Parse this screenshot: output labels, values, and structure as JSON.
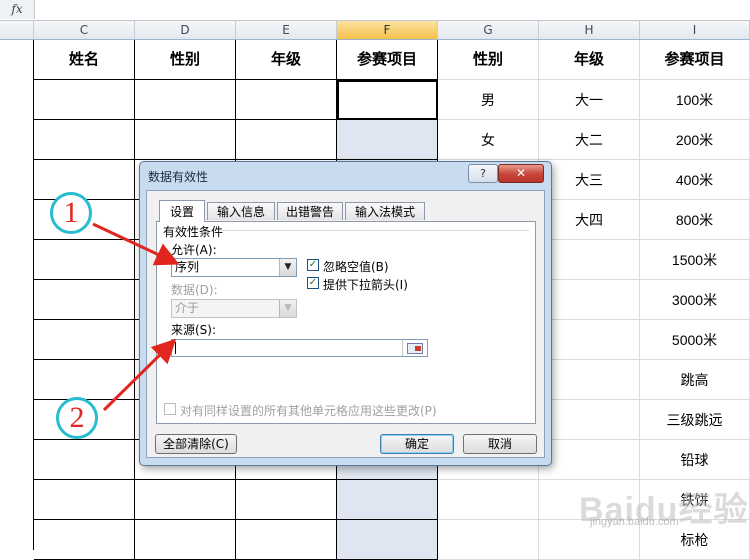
{
  "formula_bar": {
    "fx_label": "fx"
  },
  "columns": [
    {
      "letter": "C"
    },
    {
      "letter": "D"
    },
    {
      "letter": "E"
    },
    {
      "letter": "F"
    },
    {
      "letter": "G"
    },
    {
      "letter": "H"
    },
    {
      "letter": "I"
    }
  ],
  "sheet": {
    "headers": [
      "姓名",
      "性别",
      "年级",
      "参赛项目",
      "性别",
      "年级",
      "参赛项目"
    ],
    "list_gender": [
      "男",
      "女"
    ],
    "list_grade": [
      "大一",
      "大二",
      "大三",
      "大四"
    ],
    "list_events": [
      "100米",
      "200米",
      "400米",
      "800米",
      "1500米",
      "3000米",
      "5000米",
      "跳高",
      "三级跳远",
      "铅球",
      "铁饼",
      "标枪"
    ]
  },
  "dialog": {
    "title": "数据有效性",
    "help": "?",
    "close": "✕",
    "tabs": [
      "设置",
      "输入信息",
      "出错警告",
      "输入法模式"
    ],
    "group_label": "有效性条件",
    "allow_label": "允许(A):",
    "allow_value": "序列",
    "ignore_blank": "忽略空值(B)",
    "dropdown": "提供下拉箭头(I)",
    "data_label": "数据(D):",
    "data_value": "介于",
    "source_label": "来源(S):",
    "source_value": "",
    "apply_all": "对有同样设置的所有其他单元格应用这些更改(P)",
    "clear_all": "全部清除(C)",
    "ok": "确定",
    "cancel": "取消"
  },
  "annotations": {
    "mark_1": "1",
    "mark_2": "2"
  },
  "watermark": {
    "logo": "Baidu经验",
    "url": "jingyan.baidu.com"
  }
}
